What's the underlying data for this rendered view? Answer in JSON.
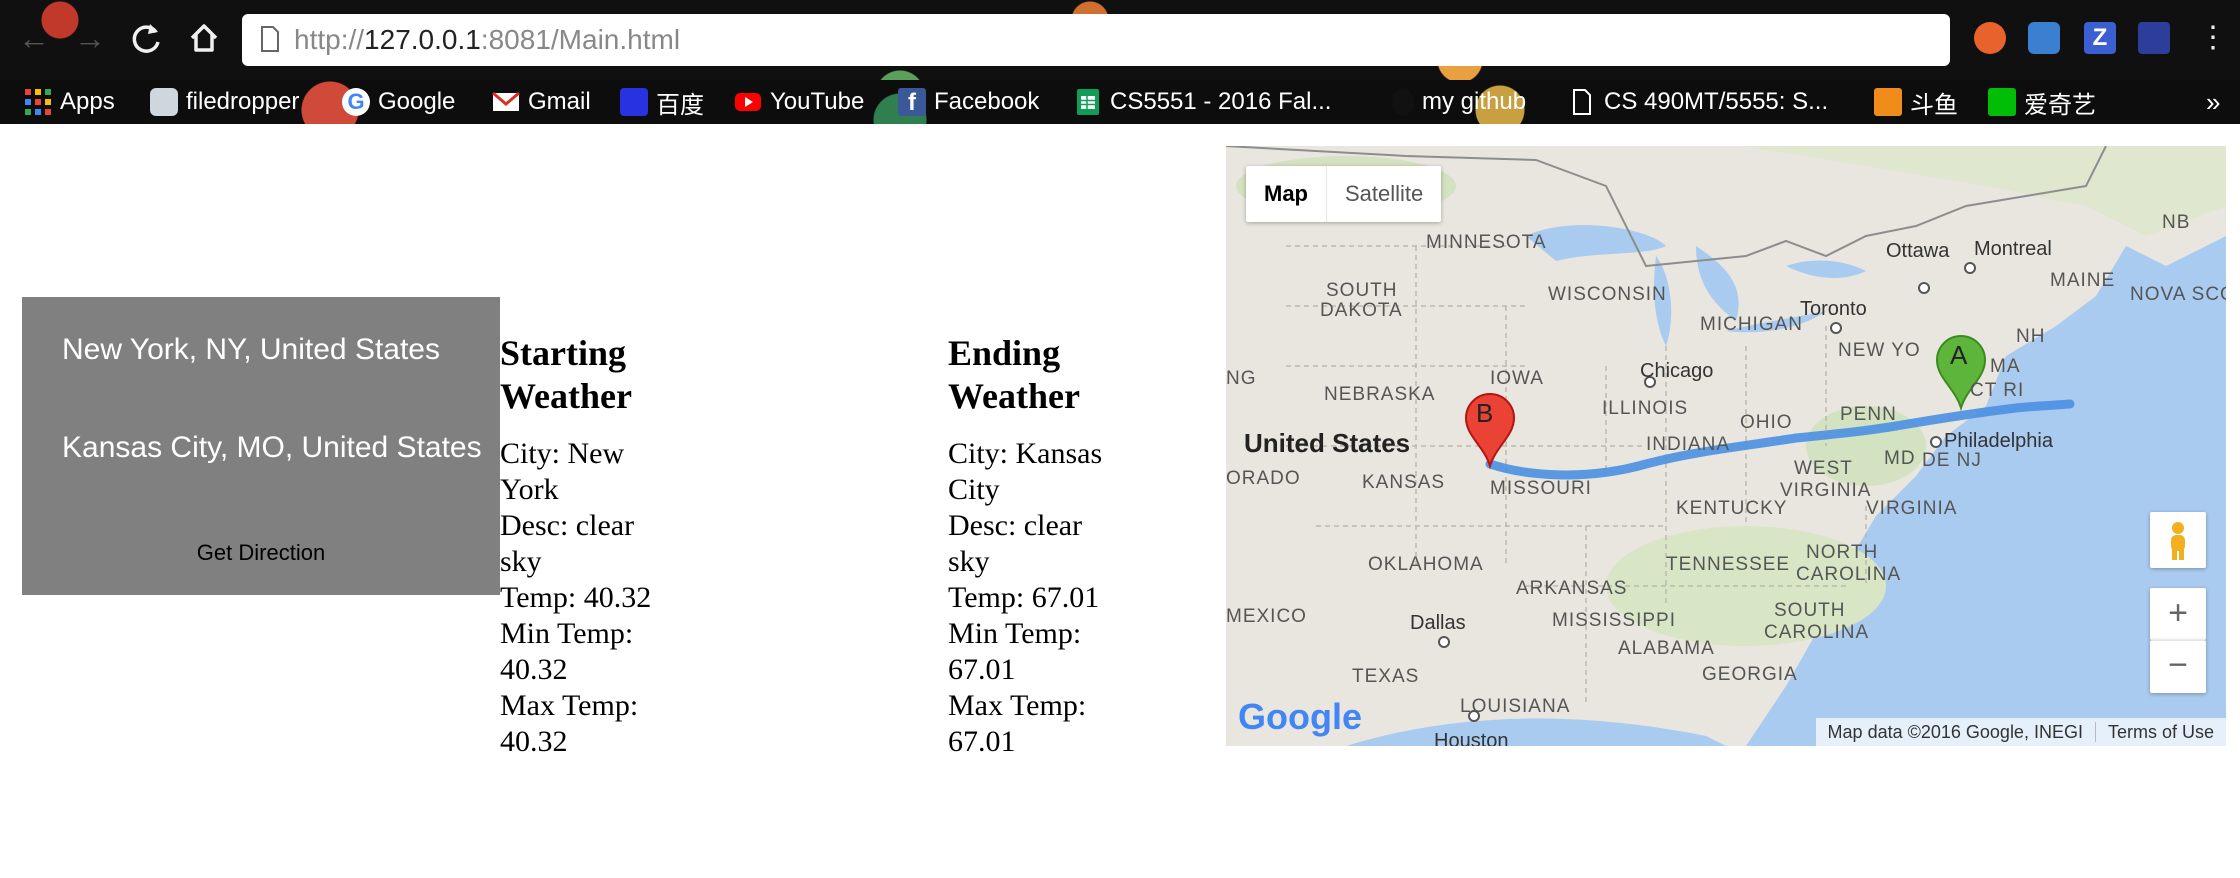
{
  "browser": {
    "url_proto": "http://",
    "url_host": "127.0.0.1",
    "url_rest": ":8081/Main.html",
    "bookmarks": [
      {
        "label": "Apps",
        "icon": "apps-grid-icon"
      },
      {
        "label": "filedropper",
        "icon": "filedropper-icon"
      },
      {
        "label": "Google",
        "icon": "google-icon"
      },
      {
        "label": "Gmail",
        "icon": "gmail-icon"
      },
      {
        "label": "百度",
        "icon": "baidu-icon"
      },
      {
        "label": "YouTube",
        "icon": "youtube-icon"
      },
      {
        "label": "Facebook",
        "icon": "facebook-icon"
      },
      {
        "label": "CS5551 - 2016 Fal...",
        "icon": "sheets-icon"
      },
      {
        "label": "my github",
        "icon": "github-icon"
      },
      {
        "label": "CS 490MT/5555: S...",
        "icon": "document-icon"
      },
      {
        "label": "斗鱼",
        "icon": "douyu-icon"
      },
      {
        "label": "爱奇艺",
        "icon": "iqiyi-icon"
      }
    ],
    "more": "»"
  },
  "form": {
    "start_value": "New York, NY, United States",
    "end_value": "Kansas City, MO, United States",
    "button_label": "Get Direction"
  },
  "start_weather": {
    "heading": "Starting Weather",
    "city": "City: New York",
    "desc": "Desc: clear sky",
    "temp": "Temp: 40.32",
    "min": "Min Temp: 40.32",
    "max": "Max Temp: 40.32"
  },
  "end_weather": {
    "heading": "Ending Weather",
    "city": "City: Kansas City",
    "desc": "Desc: clear sky",
    "temp": "Temp: 67.01",
    "min": "Min Temp: 67.01",
    "max": "Max Temp: 67.01"
  },
  "map": {
    "type_map": "Map",
    "type_satellite": "Satellite",
    "marker_a": "A",
    "marker_b": "B",
    "zoom_in": "+",
    "zoom_out": "−",
    "attribution": "Map data ©2016 Google, INEGI",
    "terms": "Terms of Use",
    "google_logo": "Google",
    "labels": {
      "minnesota": "MINNESOTA",
      "south_dakota_1": "SOUTH",
      "south_dakota_2": "DAKOTA",
      "wisconsin": "WISCONSIN",
      "michigan": "MICHIGAN",
      "iowa": "IOWA",
      "nebraska": "NEBRASKA",
      "illinois": "ILLINOIS",
      "indiana": "INDIANA",
      "ohio": "OHIO",
      "penn": "PENN",
      "new_york": "NEW YO",
      "maine": "MAINE",
      "nb": "NB",
      "nova_scotia": "NOVA SCO",
      "nh": "NH",
      "ma": "MA",
      "ct_ri": "CT RI",
      "md": "MD",
      "de_nj": "DE NJ",
      "west_virginia_1": "WEST",
      "west_virginia_2": "VIRGINIA",
      "virginia": "VIRGINIA",
      "kentucky": "KENTUCKY",
      "kansas": "KANSAS",
      "missouri": "MISSOURI",
      "orado": "ORADO",
      "ng": "NG",
      "oklahoma": "OKLAHOMA",
      "arkansas": "ARKANSAS",
      "tennessee": "TENNESSEE",
      "north_carolina_1": "NORTH",
      "north_carolina_2": "CAROLINA",
      "south_carolina_1": "SOUTH",
      "south_carolina_2": "CAROLINA",
      "mississippi": "MISSISSIPPI",
      "alabama": "ALABAMA",
      "georgia": "GEORGIA",
      "texas": "TEXAS",
      "louisiana": "LOUISIANA",
      "mexico": "MEXICO",
      "united_states": "United States",
      "chicago": "Chicago",
      "toronto": "Toronto",
      "ottawa": "Ottawa",
      "montreal": "Montreal",
      "philadelphia": "Philadelphia",
      "dallas": "Dallas",
      "houston": "Houston"
    }
  }
}
